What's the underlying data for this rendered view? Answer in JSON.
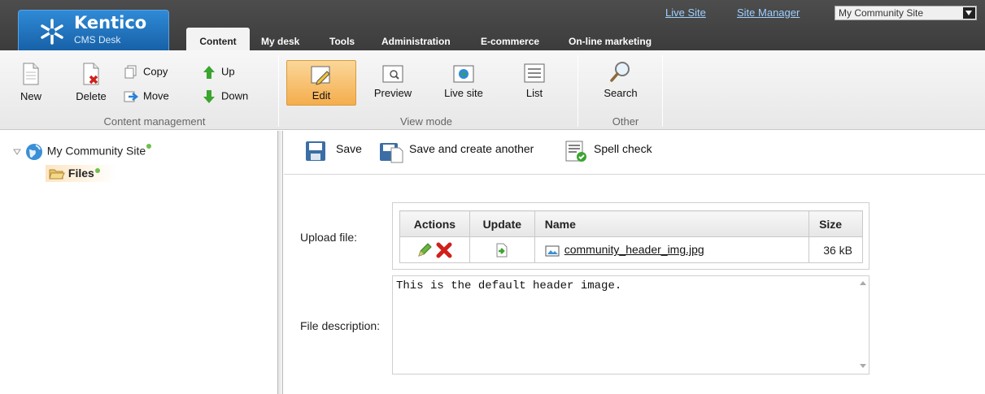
{
  "header": {
    "logo_name": "Kentico",
    "logo_sub": "CMS Desk",
    "links": [
      "Live Site",
      "Site Manager"
    ],
    "site_selector": "My Community Site",
    "tabs": [
      {
        "label": "Content",
        "active": true
      },
      {
        "label": "My desk"
      },
      {
        "label": "Tools"
      },
      {
        "label": "Administration"
      },
      {
        "label": "E-commerce"
      },
      {
        "label": "On-line marketing"
      }
    ]
  },
  "ribbon": {
    "content_management": {
      "group_label": "Content management",
      "new": "New",
      "delete": "Delete",
      "copy": "Copy",
      "move": "Move",
      "up": "Up",
      "down": "Down"
    },
    "view_mode": {
      "group_label": "View mode",
      "edit": "Edit",
      "preview": "Preview",
      "live_site": "Live site",
      "list": "List"
    },
    "other": {
      "group_label": "Other",
      "search": "Search"
    }
  },
  "tree": {
    "root": "My Community Site",
    "child": "Files"
  },
  "edit_toolbar": {
    "save": "Save",
    "save_and_create_another": "Save and create another",
    "spell_check": "Spell check"
  },
  "form": {
    "upload_label": "Upload file:",
    "description_label": "File description:",
    "table": {
      "headers": [
        "Actions",
        "Update",
        "Name",
        "Size"
      ],
      "rows": [
        {
          "name": "community_header_img.jpg",
          "size": "36 kB"
        }
      ]
    },
    "description_value": "This is the default header image."
  },
  "colors": {
    "header_bg": "#434343",
    "logo_blue": "#1f73bf",
    "link": "#9fd0ff",
    "active_view_button": "#f4ad4c",
    "status_dot": "#6cc04a"
  }
}
